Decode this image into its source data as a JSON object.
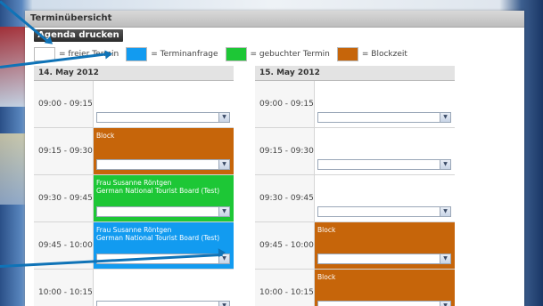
{
  "panel": {
    "title": "Terminübersicht"
  },
  "toolbar": {
    "agenda_label": "Agenda drucken"
  },
  "legend": [
    {
      "color": "#ffffff",
      "label": "= freier Termin"
    },
    {
      "color": "#129bf0",
      "label": "= Terminanfrage"
    },
    {
      "color": "#1dc736",
      "label": "= gebuchter Termin"
    },
    {
      "color": "#c6650a",
      "label": "= Blockzeit"
    }
  ],
  "days": [
    {
      "date": "14. May 2012",
      "slots": [
        {
          "time": "09:00 - 09:15",
          "status": "free",
          "text": []
        },
        {
          "time": "09:15 - 09:30",
          "status": "block",
          "text": [
            "Block"
          ]
        },
        {
          "time": "09:30 - 09:45",
          "status": "booked",
          "text": [
            "Frau Susanne Röntgen",
            "German National Tourist Board (Test)"
          ]
        },
        {
          "time": "09:45 - 10:00",
          "status": "request",
          "text": [
            "Frau Susanne Röntgen",
            "German National Tourist Board (Test)"
          ]
        },
        {
          "time": "10:00 - 10:15",
          "status": "free",
          "text": []
        }
      ]
    },
    {
      "date": "15. May 2012",
      "slots": [
        {
          "time": "09:00 - 09:15",
          "status": "free",
          "text": []
        },
        {
          "time": "09:15 - 09:30",
          "status": "free",
          "text": []
        },
        {
          "time": "09:30 - 09:45",
          "status": "free",
          "text": []
        },
        {
          "time": "09:45 - 10:00",
          "status": "block",
          "text": [
            "Block"
          ]
        },
        {
          "time": "10:00 - 10:15",
          "status": "block",
          "text": [
            "Block"
          ]
        }
      ]
    }
  ],
  "colors": {
    "free": "#ffffff",
    "request": "#129bf0",
    "booked": "#1dc736",
    "block": "#c6650a",
    "pointer": "#0f73b7"
  }
}
